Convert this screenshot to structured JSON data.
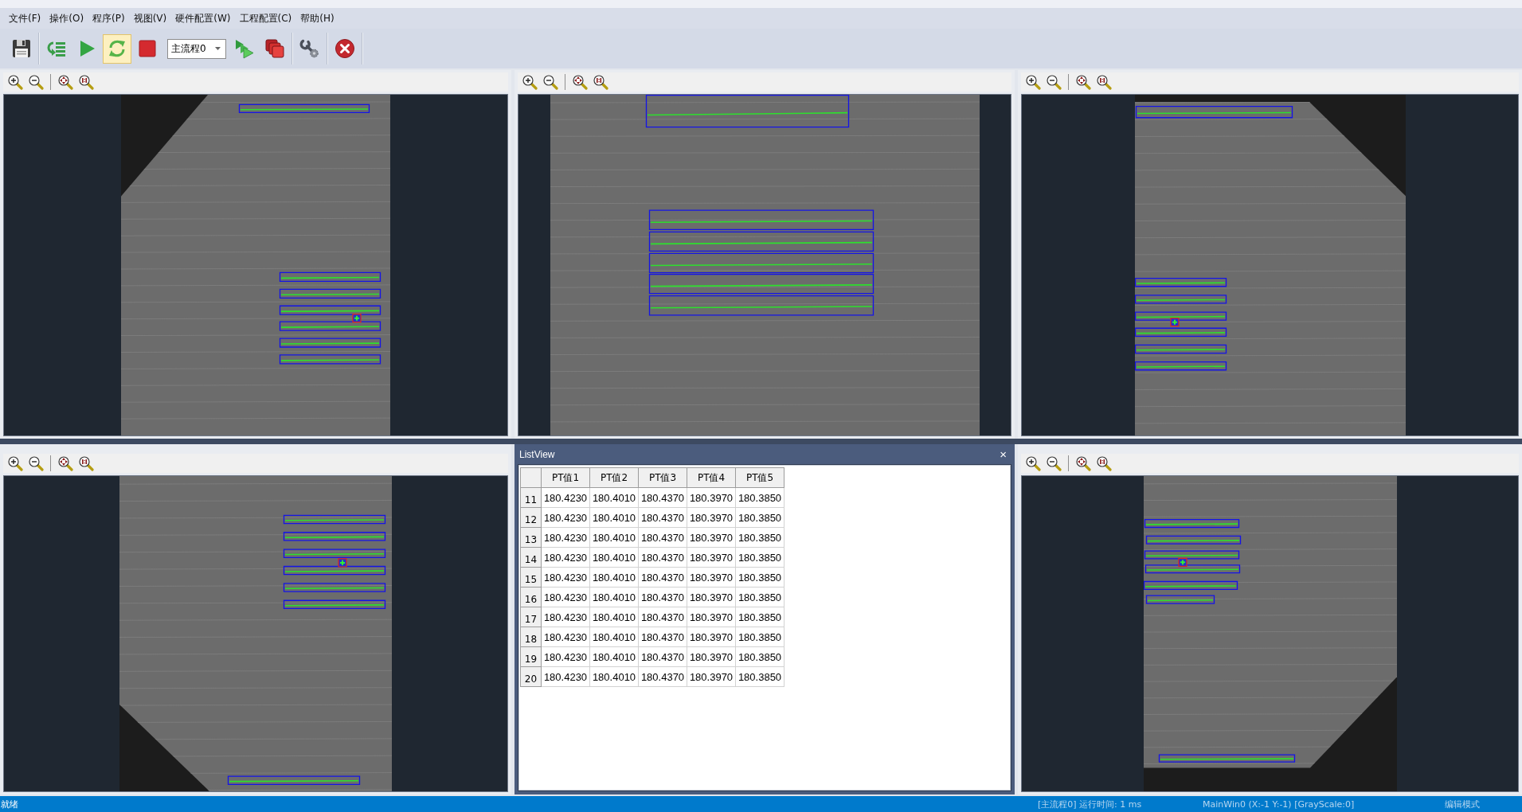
{
  "menu": [
    "文件(F)",
    "操作(O)",
    "程序(P)",
    "视图(V)",
    "硬件配置(W)",
    "工程配置(C)",
    "帮助(H)"
  ],
  "toolbar_groups": [
    {
      "items": [
        {
          "kind": "save",
          "active": false
        }
      ]
    },
    {
      "items": [
        {
          "kind": "step",
          "active": false
        },
        {
          "kind": "run",
          "active": false
        },
        {
          "kind": "loop",
          "active": true
        },
        {
          "kind": "stop",
          "active": false
        },
        {
          "kind": "select",
          "value": "主流程0"
        },
        {
          "kind": "batch",
          "active": false
        },
        {
          "kind": "windows",
          "active": false
        }
      ]
    },
    {
      "items": [
        {
          "kind": "tools",
          "active": false
        }
      ]
    },
    {
      "items": [
        {
          "kind": "exit",
          "active": false
        }
      ]
    }
  ],
  "panes": [
    {
      "kind": "image_view"
    },
    {
      "kind": "image_view"
    },
    {
      "kind": "image_view"
    },
    {
      "kind": "image_view"
    },
    {
      "kind": "list_view",
      "title": "ListView",
      "close": "×",
      "columns": [
        "PT值1",
        "PT值2",
        "PT值3",
        "PT值4",
        "PT值5"
      ],
      "rows": [
        {
          "header": "11",
          "cells": [
            "180.4230",
            "180.4010",
            "180.4370",
            "180.3970",
            "180.3850"
          ]
        },
        {
          "header": "12",
          "cells": [
            "180.4230",
            "180.4010",
            "180.4370",
            "180.3970",
            "180.3850"
          ]
        },
        {
          "header": "13",
          "cells": [
            "180.4230",
            "180.4010",
            "180.4370",
            "180.3970",
            "180.3850"
          ]
        },
        {
          "header": "14",
          "cells": [
            "180.4230",
            "180.4010",
            "180.4370",
            "180.3970",
            "180.3850"
          ]
        },
        {
          "header": "15",
          "cells": [
            "180.4230",
            "180.4010",
            "180.4370",
            "180.3970",
            "180.3850"
          ]
        },
        {
          "header": "16",
          "cells": [
            "180.4230",
            "180.4010",
            "180.4370",
            "180.3970",
            "180.3850"
          ]
        },
        {
          "header": "17",
          "cells": [
            "180.4230",
            "180.4010",
            "180.4370",
            "180.3970",
            "180.3850"
          ]
        },
        {
          "header": "18",
          "cells": [
            "180.4230",
            "180.4010",
            "180.4370",
            "180.3970",
            "180.3850"
          ]
        },
        {
          "header": "19",
          "cells": [
            "180.4230",
            "180.4010",
            "180.4370",
            "180.3970",
            "180.3850"
          ]
        },
        {
          "header": "20",
          "cells": [
            "180.4230",
            "180.4010",
            "180.4370",
            "180.3970",
            "180.3850"
          ]
        }
      ]
    },
    {
      "kind": "image_view"
    }
  ],
  "status_bar": {
    "state": "就绪",
    "flow_time": "[主流程0] 运行时间: 1 ms",
    "cursor": "MainWin0 (X:-1 Y:-1) [GrayScale:0]",
    "mode": "编辑模式"
  }
}
